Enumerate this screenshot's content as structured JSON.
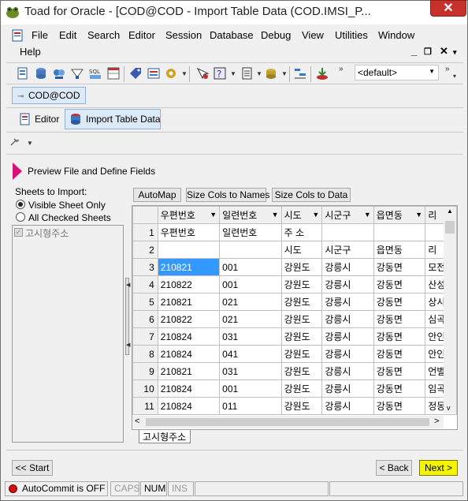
{
  "window": {
    "title": "Toad for Oracle - [COD@COD - Import Table Data (COD.IMSI_P..."
  },
  "menu": {
    "file": "File",
    "edit": "Edit",
    "search": "Search",
    "editor": "Editor",
    "session": "Session",
    "database": "Database",
    "debug": "Debug",
    "view": "View",
    "utilities": "Utilities",
    "window": "Window",
    "help": "Help"
  },
  "toolbar": {
    "schema_combo": "<default>"
  },
  "connection": {
    "label": "COD@COD"
  },
  "tabs": {
    "editor": "Editor",
    "import": "Import Table Data"
  },
  "step": {
    "title": "Preview File and Define Fields"
  },
  "sheets": {
    "label": "Sheets to Import:",
    "opt_visible": "Visible Sheet Only",
    "opt_all": "All Checked Sheets",
    "items": [
      "고시형주소"
    ]
  },
  "grid_buttons": {
    "automap": "AutoMap",
    "cols_names": "Size Cols to Names",
    "cols_data": "Size Cols to Data"
  },
  "grid": {
    "columns": [
      "우편번호",
      "일련번호",
      "시도",
      "시군구",
      "읍면동",
      "리"
    ],
    "rows": [
      [
        "1",
        "우편번호",
        "일련번호",
        "주    소",
        "",
        "",
        ""
      ],
      [
        "2",
        "",
        "",
        "시도",
        "시군구",
        "읍면동",
        "리"
      ],
      [
        "3",
        "210821",
        "001",
        "강원도",
        "강릉시",
        "강동면",
        "모전"
      ],
      [
        "4",
        "210822",
        "001",
        "강원도",
        "강릉시",
        "강동면",
        "산성"
      ],
      [
        "5",
        "210821",
        "021",
        "강원도",
        "강릉시",
        "강동면",
        "상시"
      ],
      [
        "6",
        "210822",
        "021",
        "강원도",
        "강릉시",
        "강동면",
        "심곡"
      ],
      [
        "7",
        "210824",
        "031",
        "강원도",
        "강릉시",
        "강동면",
        "안인"
      ],
      [
        "8",
        "210824",
        "041",
        "강원도",
        "강릉시",
        "강동면",
        "안인"
      ],
      [
        "9",
        "210821",
        "031",
        "강원도",
        "강릉시",
        "강동면",
        "언별"
      ],
      [
        "10",
        "210824",
        "001",
        "강원도",
        "강릉시",
        "강동면",
        "임곡"
      ],
      [
        "11",
        "210824",
        "011",
        "강원도",
        "강릉시",
        "강동면",
        "정동"
      ]
    ],
    "sheet_tab": "고시형주소"
  },
  "nav": {
    "start": "<< Start",
    "back": "< Back",
    "next": "Next >"
  },
  "status": {
    "autocommit": "AutoCommit is OFF",
    "caps": "CAPS",
    "num": "NUM",
    "ins": "INS"
  },
  "colors": {
    "accent": "#d4127a",
    "selection": "#3399ff",
    "next_highlight": "#f5f500"
  }
}
